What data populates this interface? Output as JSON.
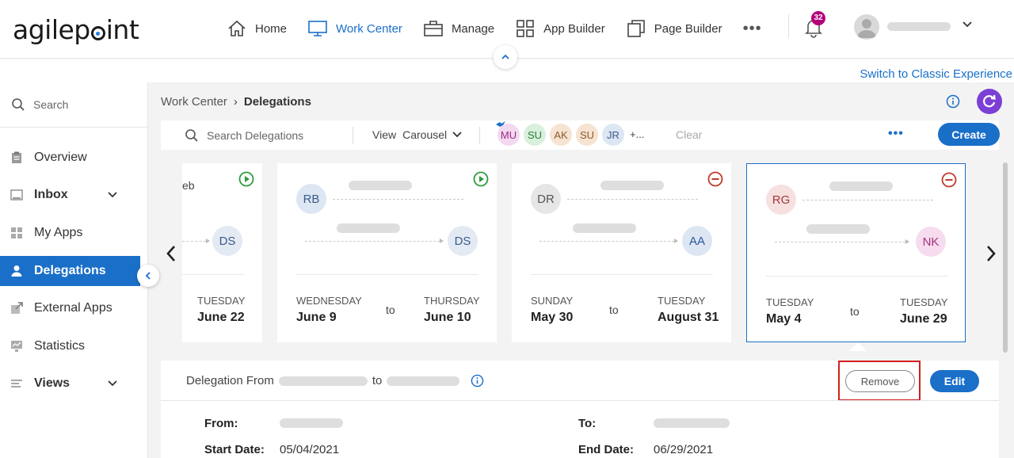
{
  "brand": {
    "logo_left": "agilep",
    "logo_right": "int"
  },
  "nav": {
    "items": [
      {
        "label": "Home",
        "icon": "home-icon"
      },
      {
        "label": "Work Center",
        "icon": "monitor-icon",
        "active": true
      },
      {
        "label": "Manage",
        "icon": "briefcase-icon"
      },
      {
        "label": "App Builder",
        "icon": "grid-icon"
      },
      {
        "label": "Page Builder",
        "icon": "pages-icon"
      }
    ],
    "more": "•••",
    "notifications": "32"
  },
  "classic_link": "Switch to Classic Experience",
  "sidebar": {
    "search_placeholder": "Search",
    "items": [
      {
        "label": "Overview"
      },
      {
        "label": "Inbox"
      },
      {
        "label": "My Apps"
      },
      {
        "label": "Delegations",
        "active": true
      },
      {
        "label": "External Apps"
      },
      {
        "label": "Statistics"
      },
      {
        "label": "Views"
      }
    ]
  },
  "breadcrumb": {
    "root": "Work Center",
    "sep": "›",
    "current": "Delegations"
  },
  "toolbar": {
    "search_placeholder": "Search Delegations",
    "view_label": "View",
    "view_value": "Carousel",
    "avatars": [
      {
        "initials": "MU",
        "bg": "#f3d9ef",
        "fg": "#9b2b8a"
      },
      {
        "initials": "SU",
        "bg": "#d8f0dc",
        "fg": "#2e7d3a"
      },
      {
        "initials": "AK",
        "bg": "#f6e3d2",
        "fg": "#8a5a2b"
      },
      {
        "initials": "SU",
        "bg": "#f6e3d2",
        "fg": "#8a5a2b"
      },
      {
        "initials": "JR",
        "bg": "#dde6f3",
        "fg": "#3b5b8a"
      }
    ],
    "avatars_more": "+...",
    "clear": "Clear",
    "more": "•••",
    "create": "Create"
  },
  "cards": [
    {
      "from": "",
      "from_partial": "eb",
      "to": "DS",
      "status": "active",
      "start_day": "",
      "start_date": "",
      "end_day": "TUESDAY",
      "end_date": "June 22",
      "to_bg": "#e3eaf3",
      "to_fg": "#3b5b8a"
    },
    {
      "from": "RB",
      "to": "DS",
      "status": "active",
      "start_day": "WEDNESDAY",
      "start_date": "June 9",
      "end_day": "THURSDAY",
      "end_date": "June 10",
      "from_bg": "#dde6f3",
      "from_fg": "#3b5b8a",
      "to_bg": "#e3eaf3",
      "to_fg": "#3b5b8a"
    },
    {
      "from": "DR",
      "to": "AA",
      "status": "inactive",
      "start_day": "SUNDAY",
      "start_date": "May 30",
      "end_day": "TUESDAY",
      "end_date": "August 31",
      "from_bg": "#e6e6e6",
      "from_fg": "#555555",
      "to_bg": "#dde6f3",
      "to_fg": "#2a5a9b"
    },
    {
      "from": "RG",
      "to": "NK",
      "status": "inactive",
      "start_day": "TUESDAY",
      "start_date": "May 4",
      "end_day": "TUESDAY",
      "end_date": "June 29",
      "from_bg": "#f6e0e0",
      "from_fg": "#a33a3a",
      "to_bg": "#f6dcee",
      "to_fg": "#a3337e",
      "selected": true
    }
  ],
  "card_to": "to",
  "details": {
    "heading_prefix": "Delegation From",
    "heading_mid": "to",
    "remove": "Remove",
    "edit": "Edit",
    "from_label": "From:",
    "to_label": "To:",
    "start_label": "Start Date:",
    "start_value": "05/04/2021",
    "end_label": "End Date:",
    "end_value": "06/29/2021"
  },
  "colors": {
    "accent": "#1a6fc9",
    "active_status": "#2e9c3e",
    "inactive_status": "#c0392b",
    "highlight": "#d21f1f",
    "refresh": "#7b3fd6"
  }
}
